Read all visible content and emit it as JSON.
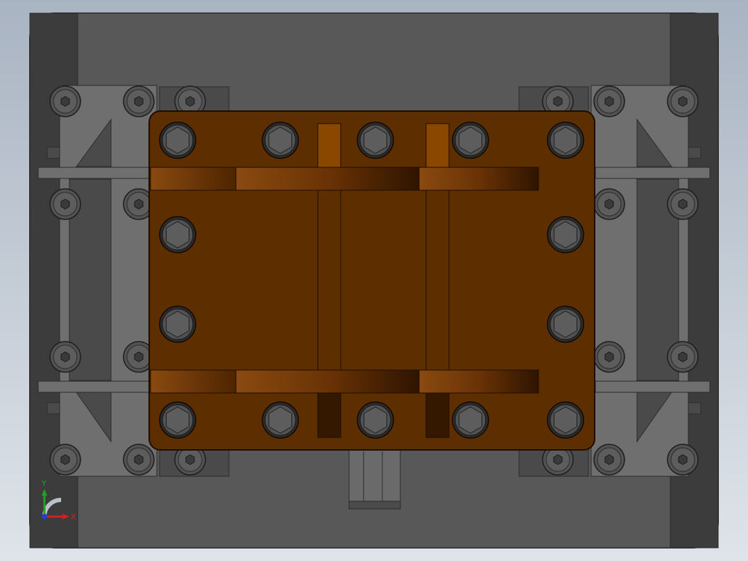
{
  "colors": {
    "bg_top": "#a9b4c2",
    "bg_bottom": "#dfe4ea",
    "base_plate": "#585858",
    "base_edge": "#2a2a2a",
    "side_rail": "#3c3c3c",
    "bracket": "#6f6f6f",
    "bracket_dark": "#4a4a4a",
    "bolt_ring": "#525252",
    "bolt_face": "#5d5d5d",
    "top_plate": "#5c2e00",
    "top_plate_edge": "#1e0c00",
    "brass_slot": "#8a4700",
    "slot_dark": "#351800",
    "clamp_bar": "#6e3806",
    "motor": "#6a6a6a",
    "axis_y": "#22a022",
    "axis_x": "#d42020",
    "axis_z": "#2040d0"
  },
  "triad": {
    "x_label": "X",
    "y_label": "Y"
  },
  "icons": {
    "orientation": "axis-triad-icon",
    "fastener": "socket-head-bolt-icon",
    "hex": "hex-bolt-icon"
  }
}
